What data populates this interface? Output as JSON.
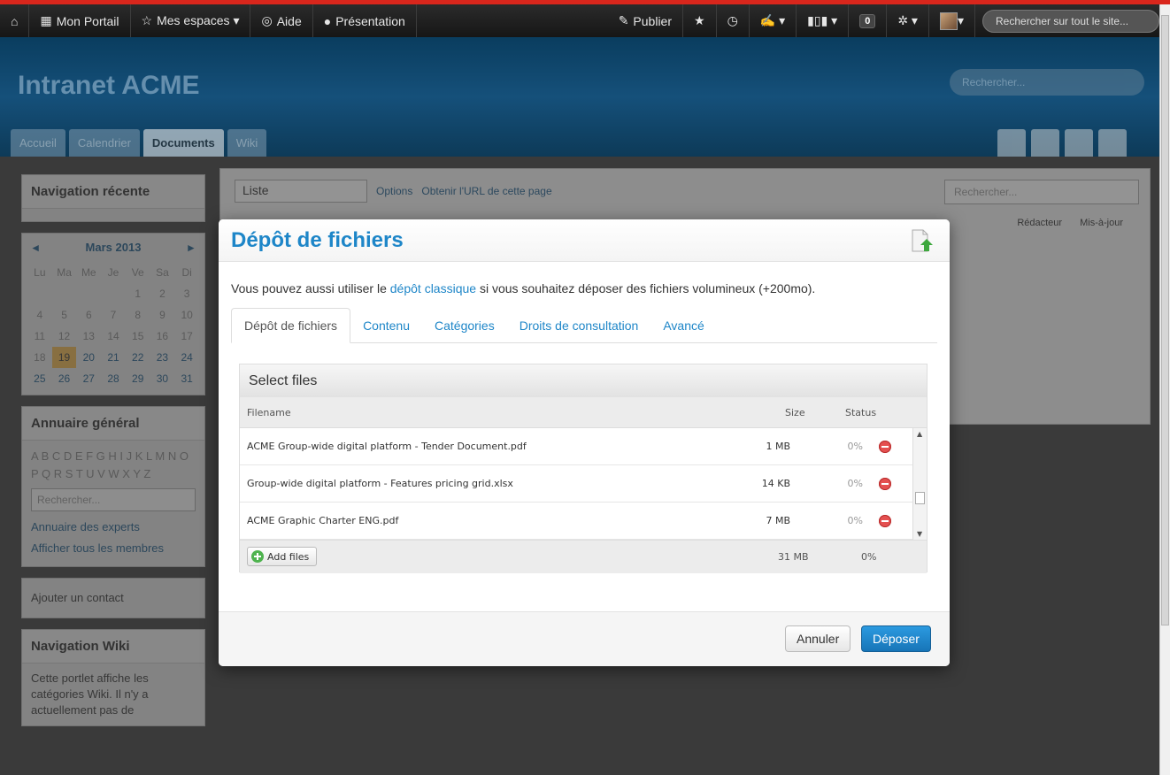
{
  "topbar": {
    "home_icon": "home-icon",
    "items": [
      {
        "label": "Mon Portail",
        "icon": "grid-icon",
        "glyph": "▦"
      },
      {
        "label": "Mes espaces ▾",
        "icon": "star-outline-icon",
        "glyph": "☆"
      },
      {
        "label": "Aide",
        "icon": "lifebuoy-icon",
        "glyph": "◎"
      },
      {
        "label": "Présentation",
        "icon": "info-icon",
        "glyph": "●"
      }
    ],
    "publish_label": "Publier",
    "notifications_count": "0",
    "search_placeholder": "Rechercher sur tout le site..."
  },
  "header": {
    "brand": "Intranet ACME",
    "search_placeholder": "Rechercher...",
    "tabs": [
      "Accueil",
      "Calendrier",
      "Documents",
      "Wiki"
    ],
    "active_tab": "Documents"
  },
  "left": {
    "recent_nav_title": "Navigation récente",
    "calendar": {
      "month": "Mars 2013",
      "weekdays": [
        "Lu",
        "Ma",
        "Me",
        "Je",
        "Ve",
        "Sa",
        "Di"
      ],
      "days": [
        "",
        "",
        "",
        "",
        "1",
        "2",
        "3",
        "4",
        "5",
        "6",
        "7",
        "8",
        "9",
        "10",
        "11",
        "12",
        "13",
        "14",
        "15",
        "16",
        "17",
        "18",
        "19",
        "20",
        "21",
        "22",
        "23",
        "24",
        "25",
        "26",
        "27",
        "28",
        "29",
        "30",
        "31"
      ],
      "today": "19"
    },
    "directory_title": "Annuaire général",
    "letters": "A B C D E F G H I J K L M N O P Q R S T U V W X Y Z",
    "dir_search_placeholder": "Rechercher...",
    "experts_link": "Annuaire des experts",
    "members_link": "Afficher tous les membres",
    "add_contact": "Ajouter un contact",
    "wiki_title": "Navigation Wiki",
    "wiki_text": "Cette portlet affiche les catégories Wiki. Il n'y a actuellement pas de"
  },
  "main": {
    "view_select": "Liste",
    "options_link": "Options",
    "url_link": "Obtenir l'URL de cette page",
    "search_placeholder": "Rechercher...",
    "col_author": "Rédacteur",
    "col_updated": "Mis-à-jour"
  },
  "modal": {
    "title": "Dépôt de fichiers",
    "info_before": "Vous pouvez aussi utiliser le ",
    "info_link": "dépôt classique",
    "info_after": " si vous souhaitez déposer des fichiers volumineux (+200mo).",
    "tabs": [
      "Dépôt de fichiers",
      "Contenu",
      "Catégories",
      "Droits de consultation",
      "Avancé"
    ],
    "active_tab": "Dépôt de fichiers",
    "uploader": {
      "title": "Select files",
      "col_filename": "Filename",
      "col_size": "Size",
      "col_status": "Status",
      "files": [
        {
          "name": "ACME Group-wide digital platform - Tender Document.pdf",
          "size": "1 MB",
          "status": "0%"
        },
        {
          "name": "Group-wide digital platform - Features pricing grid.xlsx",
          "size": "14 KB",
          "status": "0%"
        },
        {
          "name": "ACME Graphic Charter ENG.pdf",
          "size": "7 MB",
          "status": "0%"
        }
      ],
      "add_label": "Add files",
      "total_size": "31 MB",
      "total_status": "0%"
    },
    "cancel_label": "Annuler",
    "submit_label": "Déposer"
  },
  "colors": {
    "accent": "#1e86c8",
    "topbar": "#1c1c1c",
    "header": "#15507a",
    "danger": "#e45050"
  }
}
